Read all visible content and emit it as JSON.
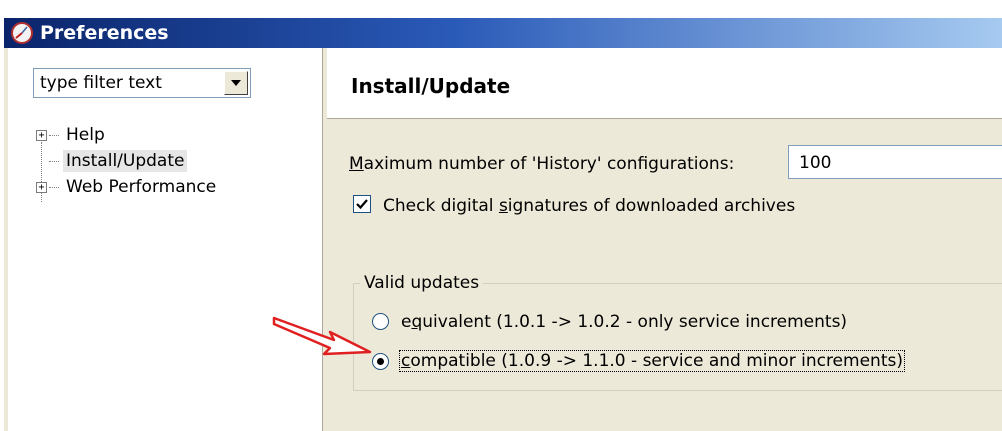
{
  "window": {
    "title": "Preferences",
    "icon": "preferences-gauge-icon"
  },
  "sidebar": {
    "filter_text": "type filter text",
    "items": [
      {
        "label": "Help",
        "expandable": true,
        "selected": false
      },
      {
        "label": "Install/Update",
        "expandable": false,
        "selected": true
      },
      {
        "label": "Web Performance",
        "expandable": true,
        "selected": false
      }
    ]
  },
  "page": {
    "title": "Install/Update",
    "history_label_prefix": "",
    "history_label_mnemonic": "M",
    "history_label_rest": "aximum number of 'History' configurations:",
    "history_value": "100",
    "check_label_before": "Check digital ",
    "check_label_mnemonic": "s",
    "check_label_after": "ignatures of downloaded archives",
    "check_checked": true,
    "group_title": "Valid updates",
    "radio_equivalent_before": "e",
    "radio_equivalent_mnemonic": "q",
    "radio_equivalent_after": "uivalent (1.0.1 -> 1.0.2 - only service increments)",
    "radio_compatible_mnemonic": "c",
    "radio_compatible_after": "ompatible (1.0.9 -> 1.1.0 - service and minor increments)",
    "selected_option": "compatible"
  },
  "colors": {
    "titlebar_start": "#0a246a",
    "titlebar_end": "#a6caf0",
    "annotation_arrow": "#e02020",
    "panel_bg": "#ece9d8"
  }
}
